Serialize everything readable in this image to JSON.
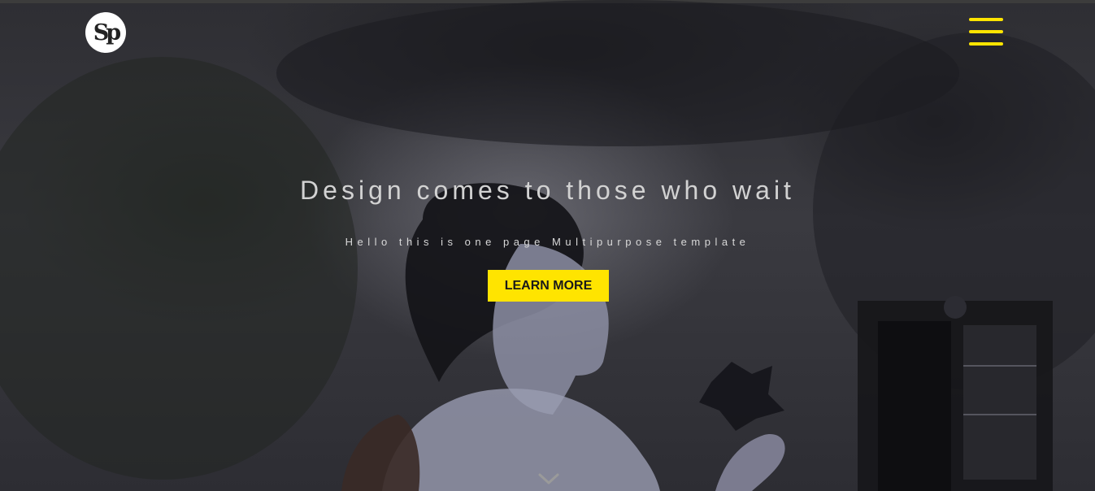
{
  "header": {
    "logo_text": "Sp",
    "menu_icon": "hamburger-menu-icon"
  },
  "hero": {
    "title": "Design comes to those who wait",
    "subtitle": "Hello this is one page Multipurpose template",
    "cta_label": "LEARN MORE",
    "scroll_icon": "chevron-down-icon"
  },
  "colors": {
    "accent": "#ffe400",
    "background": "#2e2e33",
    "title_text": "#d2d2d2"
  }
}
